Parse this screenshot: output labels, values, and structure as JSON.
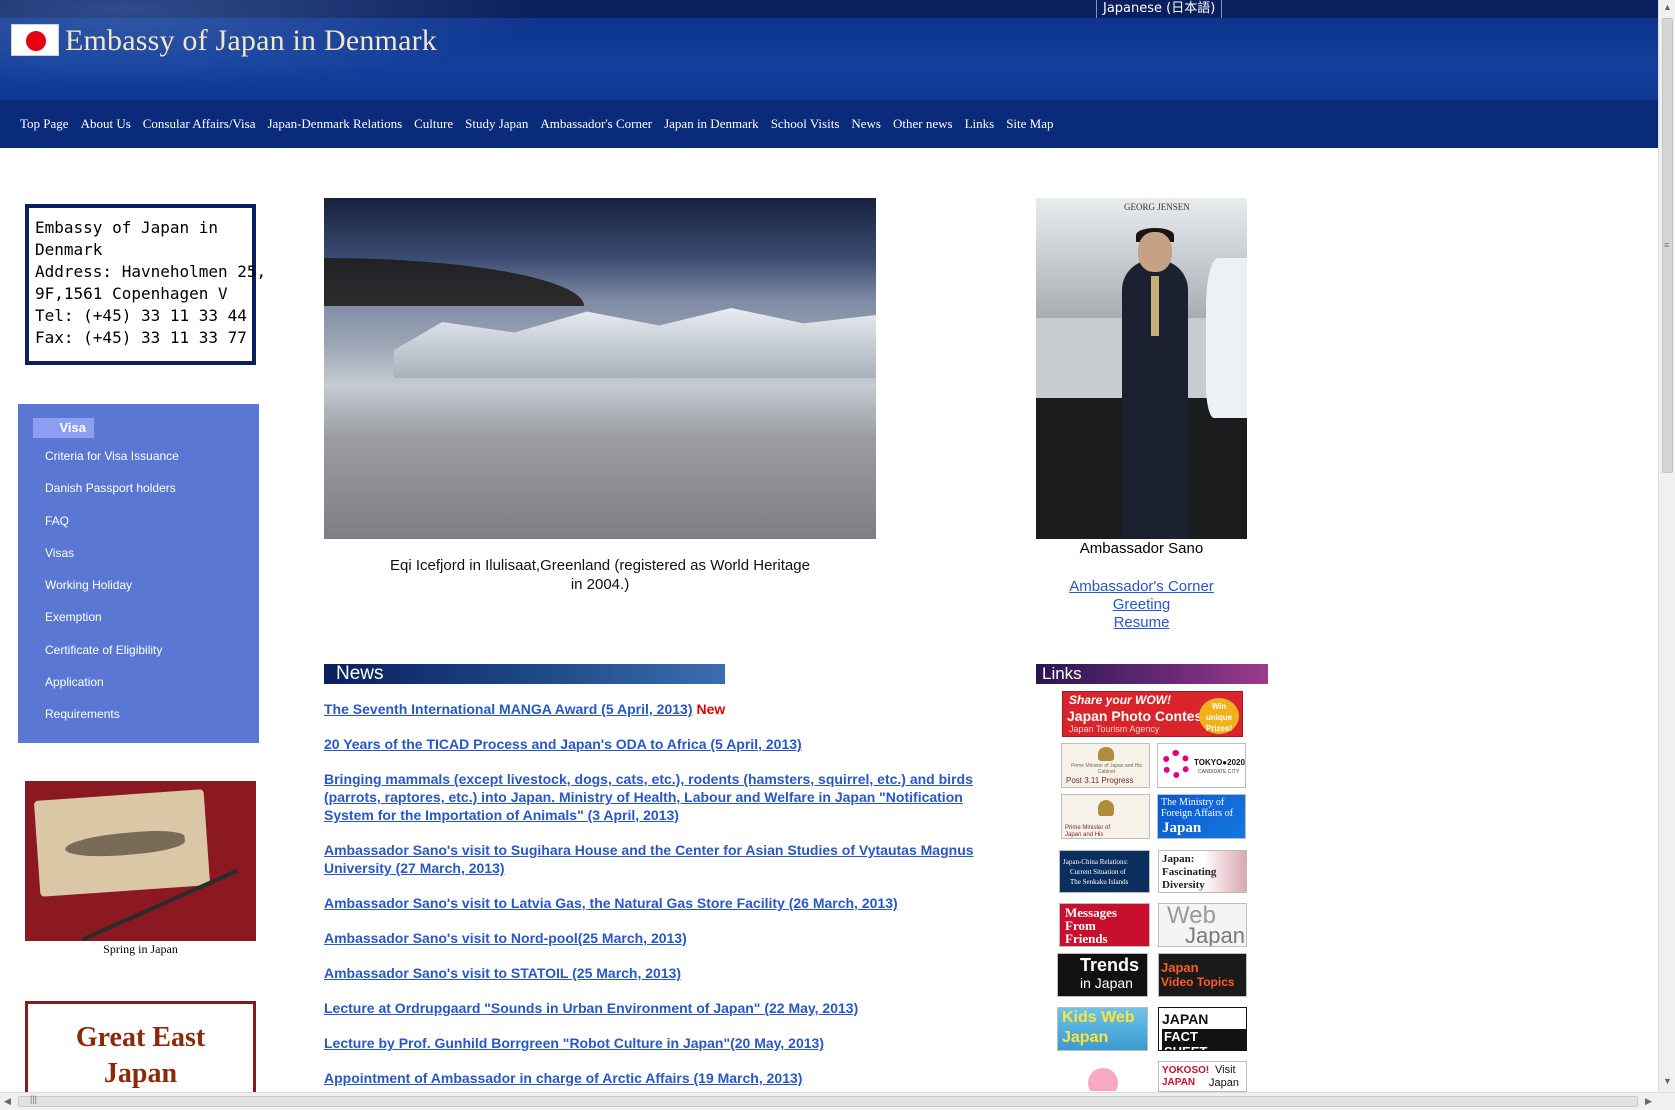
{
  "header": {
    "language_link": "Japanese (日本語)",
    "site_title": "Embassy of Japan in Denmark",
    "nav": [
      "Top Page",
      "About Us",
      "Consular Affairs/Visa",
      "Japan-Denmark Relations",
      "Culture",
      "Study Japan",
      "Ambassador's Corner",
      "Japan in Denmark",
      "School Visits",
      "News",
      "Other news",
      "Links",
      "Site Map"
    ]
  },
  "address": {
    "lines": [
      "Embassy of Japan in",
      "Denmark",
      "Address: Havneholmen 25,",
      "9F,1561 Copenhagen V",
      "Tel: (+45) 33 11 33 44",
      "Fax: (+45) 33 11 33 77"
    ]
  },
  "visa_menu": {
    "heading": "Visa",
    "items": [
      "Criteria for Visa Issuance",
      "Danish Passport holders",
      "FAQ",
      "Visas",
      "Working Holiday",
      "Exemption",
      "Certificate of Eligibility",
      "Application",
      "Requirements"
    ]
  },
  "spring": {
    "caption": "Spring in Japan"
  },
  "great_east_japan": {
    "line1": "Great East",
    "line2": "Japan"
  },
  "main_image": {
    "caption_line1": "Eqi Icefjord in Ilulisaat,Greenland (registered as World Heritage",
    "caption_line2": "in 2004.)"
  },
  "news": {
    "heading": "News",
    "new_label": "New",
    "items": [
      "The Seventh International MANGA Award (5 April, 2013)",
      "20 Years of the TICAD Process and Japan's ODA to Africa (5 April, 2013)",
      "Bringing mammals (except livestock, dogs, cats, etc.), rodents (hamsters, squirrel, etc.) and birds (parrots, raptores, etc.) into Japan. Ministry of Health, Labour and Welfare in Japan \"Notification System for the Importation of Animals\" (3 April, 2013)",
      "Ambassador Sano's visit to Sugihara House and the Center for Asian Studies of Vytautas Magnus University (27 March, 2013)",
      "Ambassador Sano's visit to Latvia Gas, the Natural Gas Store Facility (26 March, 2013)",
      "Ambassador Sano's visit to Nord-pool(25 March, 2013)",
      "Ambassador Sano's visit to STATOIL (25 March, 2013)",
      "Lecture at Ordrupgaard \"Sounds in Urban Environment of Japan\" (22 May, 2013)",
      "Lecture by Prof. Gunhild Borrgreen \"Robot Culture in Japan\"(20 May, 2013)",
      "Appointment of Ambassador in charge of Arctic Affairs (19 March, 2013)"
    ]
  },
  "ambassador": {
    "photo_sign": "GEORG JENSEN",
    "name": "Ambassador Sano",
    "links": [
      "Ambassador's Corner",
      "Greeting",
      "Resume"
    ]
  },
  "links_panel": {
    "heading": "Links",
    "banners": {
      "photo_contest_a": "Share your WOW!",
      "photo_contest_b": "Japan Photo Contest",
      "photo_contest_c": "Japan Tourism Agency",
      "photo_contest_badge": "Win unique Prizes!",
      "post311_a": "Prime Minister of Japan and His Cabinet",
      "post311_b": "Post 3.11 Progress",
      "tokyo2020_a": "TOKYO●2020",
      "tokyo2020_b": "CANDIDATE CITY",
      "pm_cabinet": "Prime Minister of Japan and His Cabinet",
      "mofa_a": "The Ministry of",
      "mofa_b": "Foreign Affairs of",
      "mofa_c": "Japan",
      "senkaku_a": "Japan-China Relations:",
      "senkaku_b": "Current Situation of",
      "senkaku_c": "The Senkaku Islands",
      "diversity_a": "Japan:",
      "diversity_b": "Fascinating",
      "diversity_c": "Diversity",
      "messages_a": "Messages",
      "messages_b": "From",
      "messages_c": "Friends",
      "webjapan_a": "Web",
      "webjapan_b": "Japan",
      "trends_a": "Trends",
      "trends_b": "in Japan",
      "videotopics_a": "Japan",
      "videotopics_b": "Video Topics",
      "kidsweb_a": "Kids Web",
      "kidsweb_b": "Japan",
      "factsheet_a": "JAPAN",
      "factsheet_b": "FACT SHEET",
      "yokoso_a": "YOKOSO!",
      "yokoso_b": "JAPAN",
      "yokoso_c": "Visit",
      "yokoso_d": "Japan"
    }
  },
  "colors": {
    "header_blue": "#0c2f86",
    "nav_blue": "#0a2a7a",
    "menu_blue": "#5a77d4",
    "link_blue": "#2857c7",
    "new_red": "#e60000"
  }
}
